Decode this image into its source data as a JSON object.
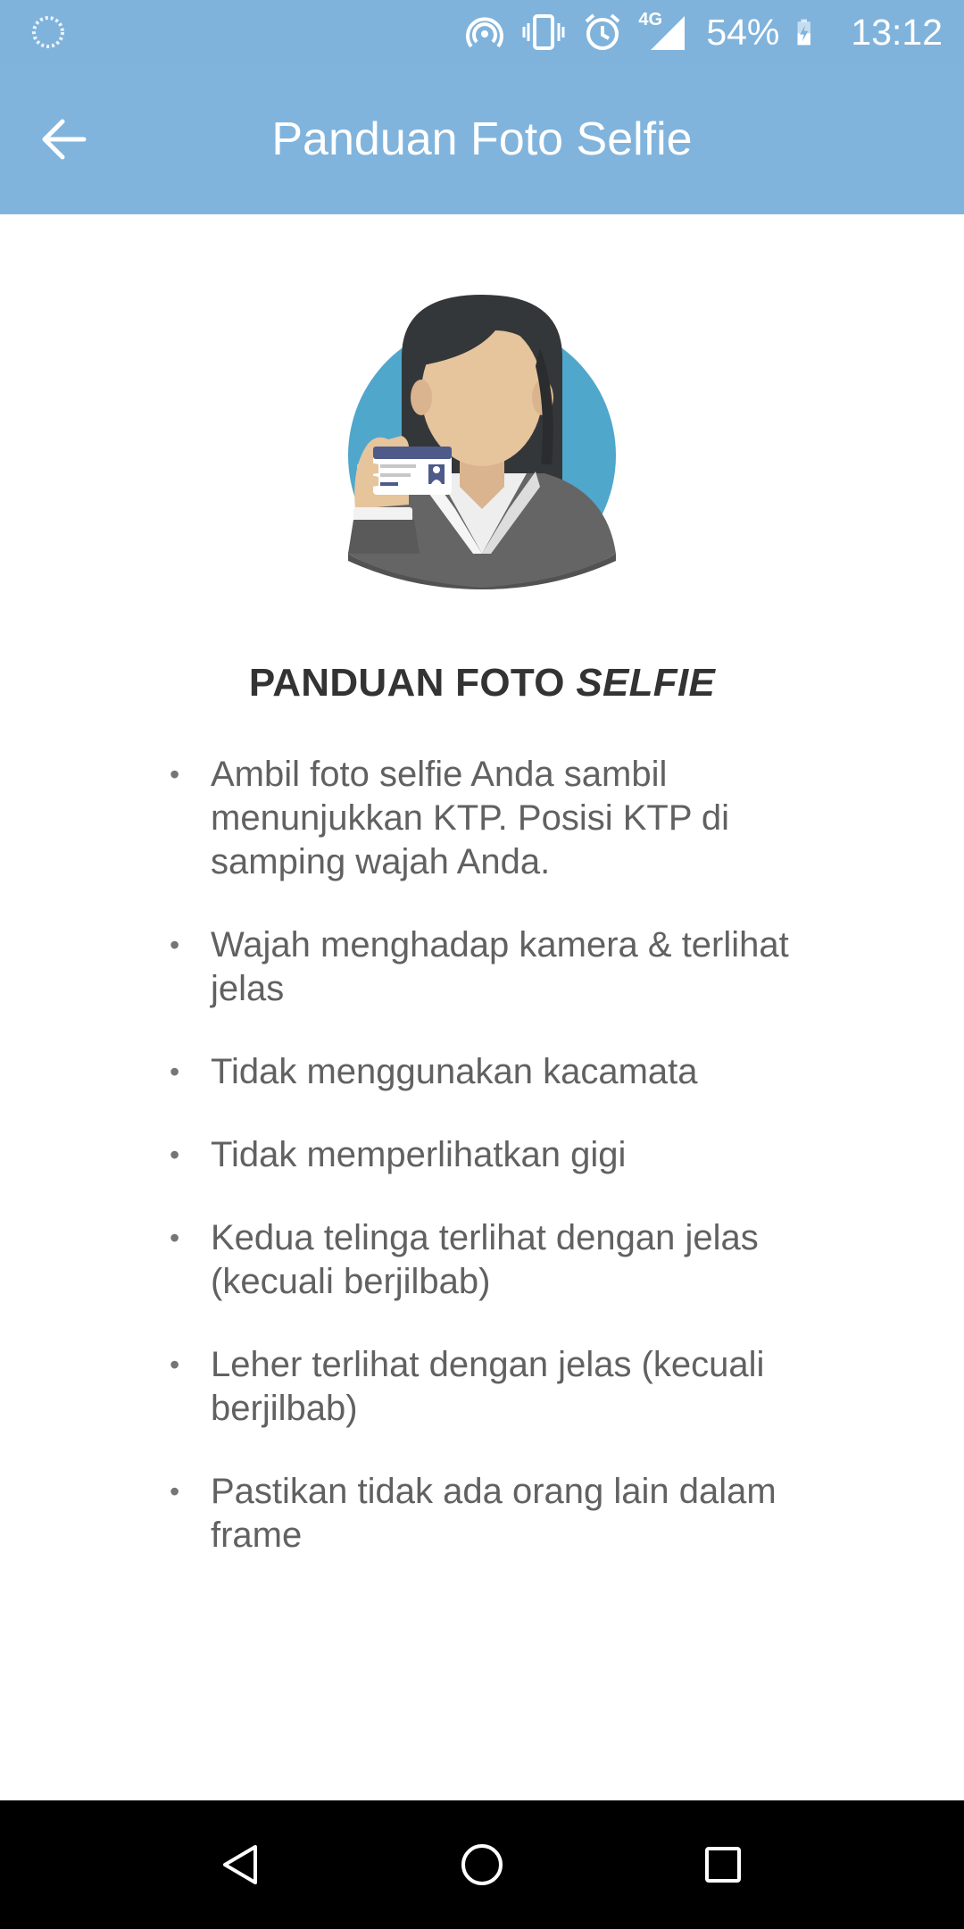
{
  "status_bar": {
    "network": "4G",
    "battery": "54%",
    "time": "13:12",
    "icons": [
      "loading-icon",
      "hotspot-icon",
      "vibrate-icon",
      "alarm-icon",
      "signal-icon",
      "battery-charging-icon"
    ]
  },
  "app_bar": {
    "title": "Panduan Foto Selfie",
    "back_icon": "arrow-back-icon"
  },
  "content": {
    "illustration_icon": "woman-holding-id-card-illustration",
    "heading_main": "PANDUAN FOTO ",
    "heading_emphasis": "SELFIE",
    "bullet": "•",
    "items": [
      "Ambil foto selfie Anda sambil menunjukkan KTP. Posisi KTP di samping wajah Anda.",
      "Wajah menghadap kamera & terlihat jelas",
      "Tidak menggunakan kacamata",
      "Tidak memperlihatkan gigi",
      "Kedua telinga terlihat dengan jelas (kecuali berjilbab)",
      "Leher terlihat dengan jelas (kecuali berjilbab)",
      "Pastikan tidak ada orang lain dalam frame"
    ]
  },
  "nav_bar": {
    "buttons": [
      "back-triangle-icon",
      "home-circle-icon",
      "recents-square-icon"
    ]
  },
  "colors": {
    "app_bar": "#80b4dd",
    "status_bar": "#7fb3dc",
    "heading_text": "#333333",
    "body_text": "#616161",
    "nav_bar": "#000000"
  }
}
